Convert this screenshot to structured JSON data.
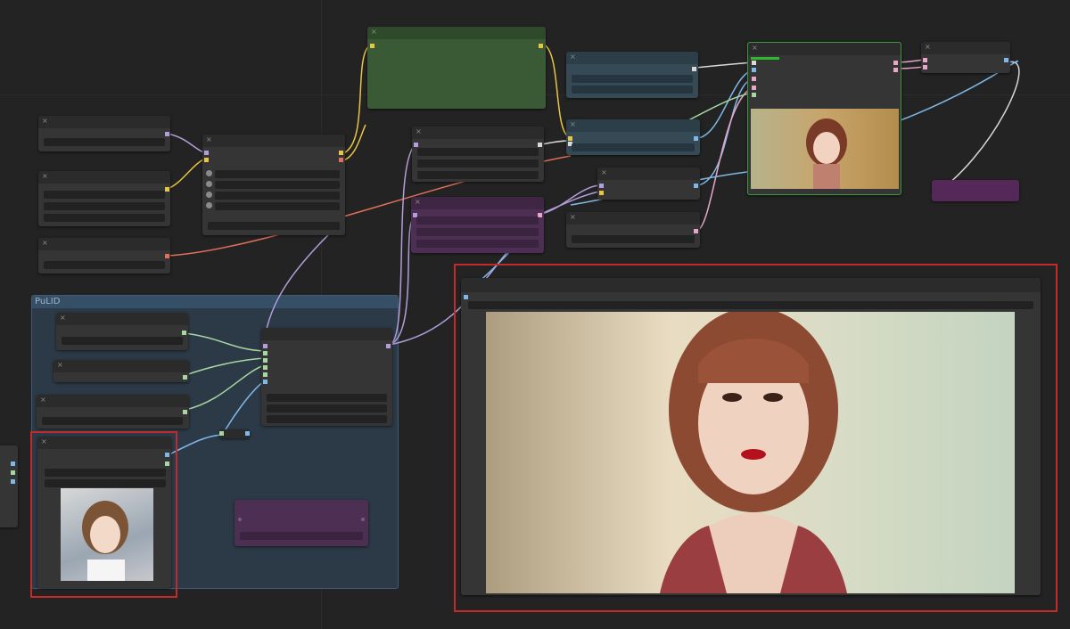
{
  "app": {
    "name": "ComfyUI node graph"
  },
  "group": {
    "title": "PuLID"
  },
  "colors": {
    "background": "#232323",
    "node_body": "#353535",
    "node_green": "#3a5a35",
    "node_teal": "#354a55",
    "node_purple": "#4c2f52",
    "group_fill": "#2c3a47",
    "highlight_red": "#c32b2b",
    "wire_yellow": "#e8c542",
    "wire_red": "#e0705a",
    "wire_purple": "#b39ddb",
    "wire_blue": "#7fb8e8",
    "wire_pink": "#e8a6c8",
    "wire_green": "#a7d6a0",
    "wire_white": "#d8d8d8"
  },
  "icons": [
    "close-icon",
    "image-preview",
    "reference-photo"
  ]
}
